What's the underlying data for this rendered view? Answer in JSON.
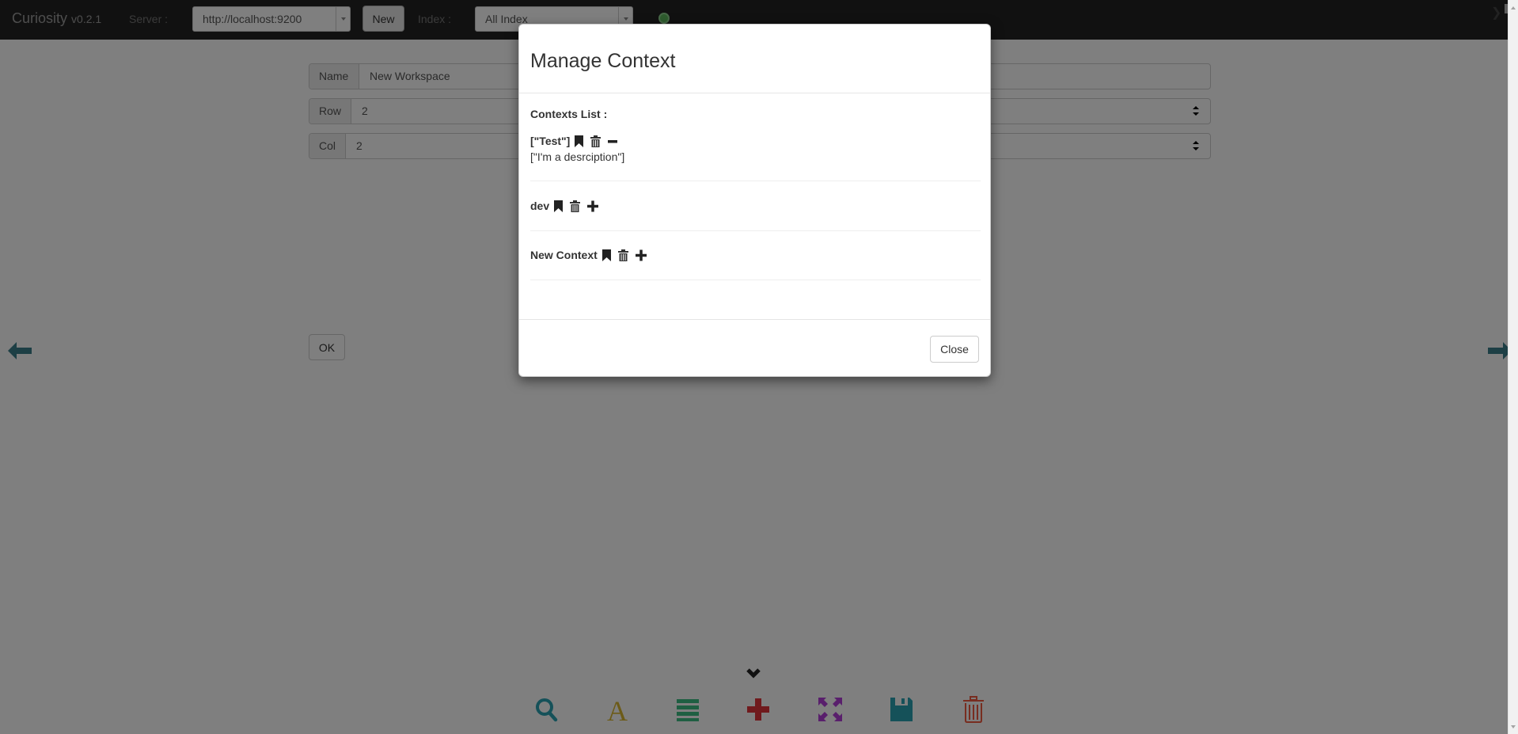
{
  "navbar": {
    "brand": "Curiosity",
    "version": "v0.2.1",
    "server_label": "Server :",
    "server_value": "http://localhost:9200",
    "new_button": "New",
    "index_label": "Index :",
    "index_value": "All Index",
    "status_color": "#5cb85c"
  },
  "form": {
    "name_label": "Name",
    "name_value": "New Workspace",
    "row_label": "Row",
    "row_value": "2",
    "col_label": "Col",
    "col_value": "2",
    "ok_button": "OK"
  },
  "nav_arrows": {
    "left_icon": "arrow-left-icon",
    "right_icon": "arrow-right-icon",
    "color": "#3a7f8a"
  },
  "toolbar": {
    "collapse_icon": "chevron-down-icon",
    "tools": [
      {
        "icon": "search-icon",
        "color": "#2aa3b3"
      },
      {
        "icon": "font-icon",
        "color": "#d9b630"
      },
      {
        "icon": "list-icon",
        "color": "#3fbf85"
      },
      {
        "icon": "plus-icon",
        "color": "#e0353a"
      },
      {
        "icon": "fullscreen-icon",
        "color": "#b33fd9"
      },
      {
        "icon": "save-icon",
        "color": "#2aa3b3"
      },
      {
        "icon": "trash-icon",
        "color": "#f05a40"
      }
    ]
  },
  "modal": {
    "title": "Manage Context",
    "list_heading": "Contexts List :",
    "contexts": [
      {
        "name": "[\"Test\"]",
        "description": "[\"I'm a desrciption\"]",
        "toggle_icon": "minus-icon"
      },
      {
        "name": "dev",
        "description": "",
        "toggle_icon": "plus-icon"
      },
      {
        "name": "New Context",
        "description": "",
        "toggle_icon": "plus-icon"
      }
    ],
    "close_button": "Close"
  }
}
